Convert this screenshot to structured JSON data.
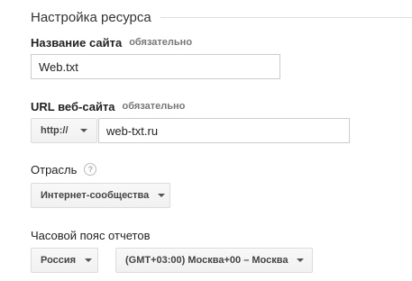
{
  "section": {
    "title": "Настройка ресурса"
  },
  "site_name": {
    "label": "Название сайта",
    "required": "обязательно",
    "value": "Web.txt"
  },
  "site_url": {
    "label": "URL веб-сайта",
    "required": "обязательно",
    "protocol": "http://",
    "value": "web-txt.ru"
  },
  "industry": {
    "label": "Отрасль",
    "help_icon": "question-mark-icon",
    "help_glyph": "?",
    "selected": "Интернет-сообщества"
  },
  "timezone": {
    "label": "Часовой пояс отчетов",
    "country": "Россия",
    "zone": "(GMT+03:00) Москва+00 – Москва"
  }
}
